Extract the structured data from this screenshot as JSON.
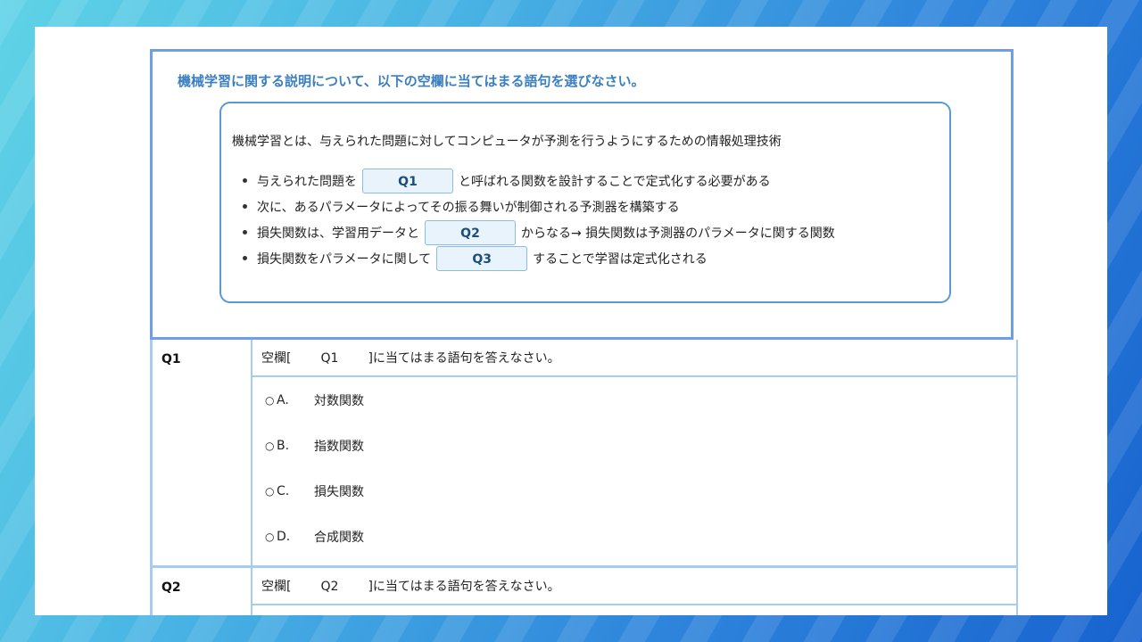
{
  "question": {
    "instruction": "機械学習に関する説明について、以下の空欄に当てはまる語句を選びなさい。",
    "summary": "機械学習とは、与えられた問題に対してコンピュータが予測を行うようにするための情報処理技術",
    "bullets": [
      {
        "before": "与えられた問題を",
        "blank": "Q1",
        "after": "と呼ばれる関数を設計することで定式化する必要がある"
      },
      {
        "before": "次に、あるパラメータによってその振る舞いが制御される予測器を構築する"
      },
      {
        "before": "損失関数は、学習用データと",
        "blank": "Q2",
        "after": "からなる→ 損失関数は予測器のパラメータに関する関数"
      },
      {
        "before": "損失関数をパラメータに関して",
        "blank": "Q3",
        "after": "することで学習は定式化される"
      }
    ]
  },
  "q1": {
    "label": "Q1",
    "prompt_pre": "空欄[",
    "prompt_blank": "Q1",
    "prompt_post": "]に当てはまる語句を答えなさい。",
    "radio_symbol": "○",
    "options": [
      {
        "letter": "A.",
        "text": "対数関数"
      },
      {
        "letter": "B.",
        "text": "指数関数"
      },
      {
        "letter": "C.",
        "text": "損失関数"
      },
      {
        "letter": "D.",
        "text": "合成関数"
      }
    ]
  },
  "q2": {
    "label": "Q2",
    "prompt_pre": "空欄[",
    "prompt_blank": "Q2",
    "prompt_post": "]に当てはまる語句を答えなさい。"
  }
}
